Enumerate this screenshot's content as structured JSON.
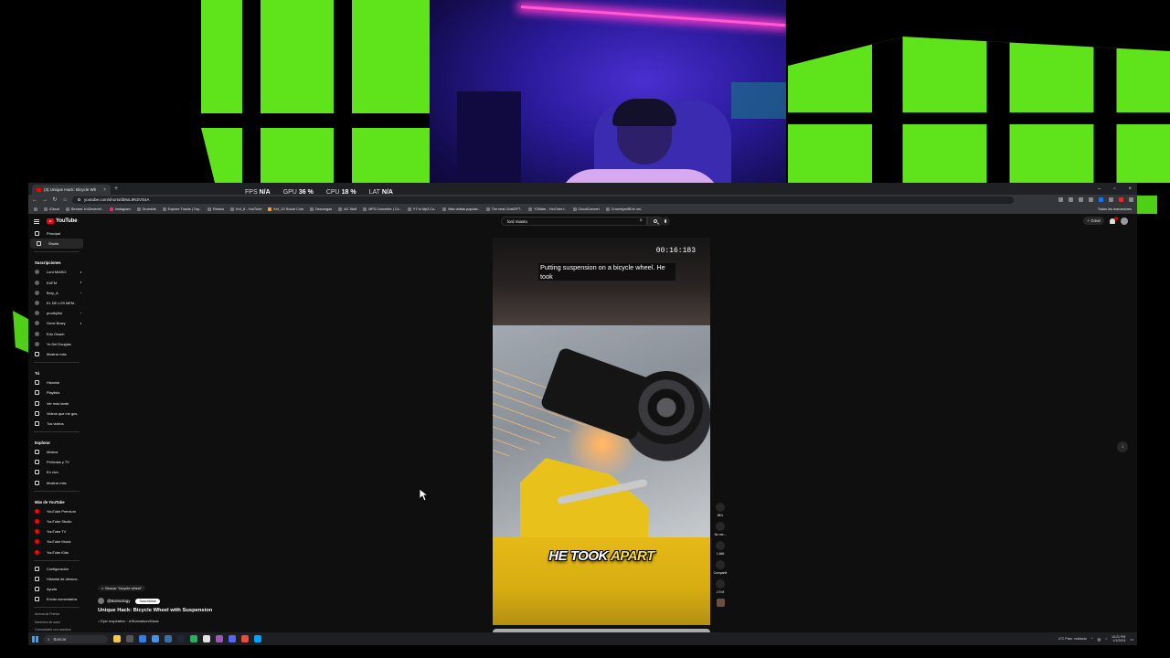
{
  "stats": {
    "fps_label": "FPS",
    "fps_value": "N/A",
    "gpu_label": "GPU",
    "gpu_value": "36 %",
    "cpu_label": "CPU",
    "cpu_value": "18 %",
    "lat_label": "LAT",
    "lat_value": "N/A"
  },
  "browser": {
    "tab_title": "(3) Unique Hack: Bicycle Wh",
    "url": "youtube.com/shorts/dMoL9N2VS4A",
    "bookmarks": [
      "iCloud",
      "YouTube",
      "Stream: KnDevenril..",
      "Instagram",
      "Drumkits",
      "Explore Tracks | Top..",
      "Retaxo",
      "Kr4_8 - YouTube",
      "Kr4_10 Social Club",
      "Descargas",
      "AC Stuff",
      "MP3 Converter | Co..",
      "YT to Mp3 Co..",
      "Más visitas popular..",
      "The best ChatGPT..",
      "Y2Mate - YouTube t..",
      "CloudConvert",
      "CrunchyrollB te uni.."
    ],
    "bookmarks_all": "Todos los marcadores"
  },
  "youtube": {
    "logo_text": "YouTube",
    "search_value": "lord miasto",
    "create_label": "Crear",
    "sidebar": {
      "top": [
        "Principal",
        "Shorts"
      ],
      "subs_header": "Suscripciones",
      "subs": [
        "Lord MIASO",
        "KUFM",
        "Bory_A",
        "EL DE LOS MEM..",
        "prodbyfiui",
        "Gone Brazy",
        "Edu Ouach",
        "Yo Dei Douglas"
      ],
      "subs_more": "Mostrar más",
      "you_header": "Tú",
      "you": [
        "Historial",
        "Playlists",
        "Ver más tarde",
        "Videos que me gus..",
        "Tus videos"
      ],
      "explore_header": "Explorar",
      "explore": [
        "Música",
        "Películas y TV",
        "En vivo"
      ],
      "explore_more": "Mostrar más",
      "more_header": "Más de YouTube",
      "more": [
        "YouTube Premium",
        "YouTube Studio",
        "YouTube TV",
        "YouTube Music",
        "YouTube Kids"
      ],
      "bottom": [
        "Configuración",
        "Historial de denunc..",
        "Ayuda",
        "Enviar comentarios"
      ],
      "footer": [
        "Acerca de  Prensa",
        "Derechos de autor",
        "Comunicarte con nosotros",
        "Creadores  Anunciar"
      ]
    },
    "short": {
      "timestamp": "00:16:183",
      "caption": "Putting suspension on a bicycle wheel. He took",
      "big_caption_a": "HE TOOK",
      "big_caption_b": "APART"
    },
    "meta": {
      "search_chip": "Buscar \"bicycle wheel\"",
      "channel": "@Bainsology",
      "subscribe": "Suscribirse",
      "title": "Unique Hack: Bicycle Wheel with Suspension",
      "music": "♪ Epic Inspiration · AShamaluevMusic"
    },
    "actions": [
      {
        "icon": "like-icon",
        "label": "88 k"
      },
      {
        "icon": "dislike-icon",
        "label": "No me..."
      },
      {
        "icon": "comment-icon",
        "label": "1,666"
      },
      {
        "icon": "share-icon",
        "label": "Compartir"
      },
      {
        "icon": "remix-icon",
        "label": "2.9 M"
      }
    ]
  },
  "taskbar": {
    "search_placeholder": "Buscar",
    "weather": "4°C  Parc. nublado",
    "time": "10:21 PM",
    "date": "1/1/2024"
  }
}
